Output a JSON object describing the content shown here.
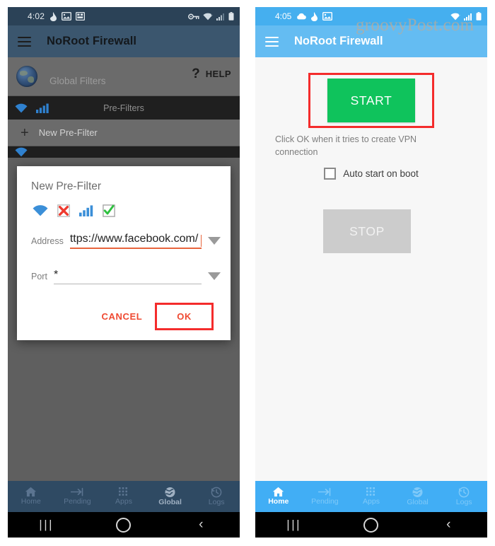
{
  "left_phone": {
    "status_bar": {
      "time": "4:02",
      "left_icons": [
        "flame-icon",
        "image-icon",
        "apps-icon"
      ],
      "right_icons": [
        "key-icon",
        "wifi-icon",
        "signal-icon",
        "battery-icon"
      ]
    },
    "app_bar": {
      "menu_icon": "hamburger-icon",
      "title": "NoRoot Firewall"
    },
    "global_row": {
      "avatar_icon": "globe-icon",
      "label": "Global Filters",
      "help_mark": "?",
      "help_label": "HELP"
    },
    "pre_filters_bar": {
      "label": "Pre-Filters",
      "icons": [
        "wifi-icon",
        "signal-bars-icon"
      ]
    },
    "new_pre_filter_row": {
      "plus_icon": "plus-icon",
      "label": "New Pre-Filter"
    },
    "dialog": {
      "title": "New Pre-Filter",
      "icons": [
        "wifi-icon",
        "red-x-icon",
        "signal-bars-icon",
        "green-check-icon"
      ],
      "address": {
        "label": "Address",
        "value": "ttps://www.facebook.com/",
        "dropdown_icon": "dropdown-triangle-icon"
      },
      "port": {
        "label": "Port",
        "value": "*",
        "dropdown_icon": "dropdown-triangle-icon"
      },
      "cancel_label": "CANCEL",
      "ok_label": "OK"
    },
    "bottom_nav": {
      "items": [
        {
          "label": "Home",
          "icon": "home-icon",
          "active": false
        },
        {
          "label": "Pending",
          "icon": "pending-arrow-icon",
          "active": false
        },
        {
          "label": "Apps",
          "icon": "apps-grid-icon",
          "active": false
        },
        {
          "label": "Global",
          "icon": "globe-icon",
          "active": true
        },
        {
          "label": "Logs",
          "icon": "history-clock-icon",
          "active": false
        }
      ]
    },
    "system_nav": {
      "recents": "|||",
      "home": "home-circle-icon",
      "back": "back-chevron-icon"
    }
  },
  "right_phone": {
    "status_bar": {
      "time": "4:05",
      "left_icons": [
        "cloud-icon",
        "flame-icon",
        "image-icon"
      ],
      "right_icons": [
        "wifi-icon",
        "signal-icon",
        "battery-icon"
      ]
    },
    "app_bar": {
      "menu_icon": "hamburger-icon",
      "title": "NoRoot Firewall"
    },
    "watermark": "groovyPost.com",
    "main": {
      "start_label": "START",
      "vpn_note": "Click OK when it tries to create VPN connection",
      "auto_start_label": "Auto start on boot",
      "auto_start_checked": false,
      "stop_label": "STOP"
    },
    "bottom_nav": {
      "items": [
        {
          "label": "Home",
          "icon": "home-icon",
          "active": true
        },
        {
          "label": "Pending",
          "icon": "pending-arrow-icon",
          "active": false
        },
        {
          "label": "Apps",
          "icon": "apps-grid-icon",
          "active": false
        },
        {
          "label": "Global",
          "icon": "globe-icon",
          "active": false
        },
        {
          "label": "Logs",
          "icon": "history-clock-icon",
          "active": false
        }
      ]
    },
    "system_nav": {
      "recents": "|||",
      "home": "home-circle-icon",
      "back": "back-chevron-icon"
    }
  },
  "colors": {
    "left_status_bar": "#2b4257",
    "left_app_bar": "#3b566e",
    "right_status_bar": "#45afef",
    "right_app_bar": "#64bcf2",
    "start_green": "#0fc35c",
    "stop_gray": "#cccccc",
    "highlight_red": "#f42c2c",
    "accent_orange": "#e8643c",
    "action_red": "#ef4a32"
  }
}
